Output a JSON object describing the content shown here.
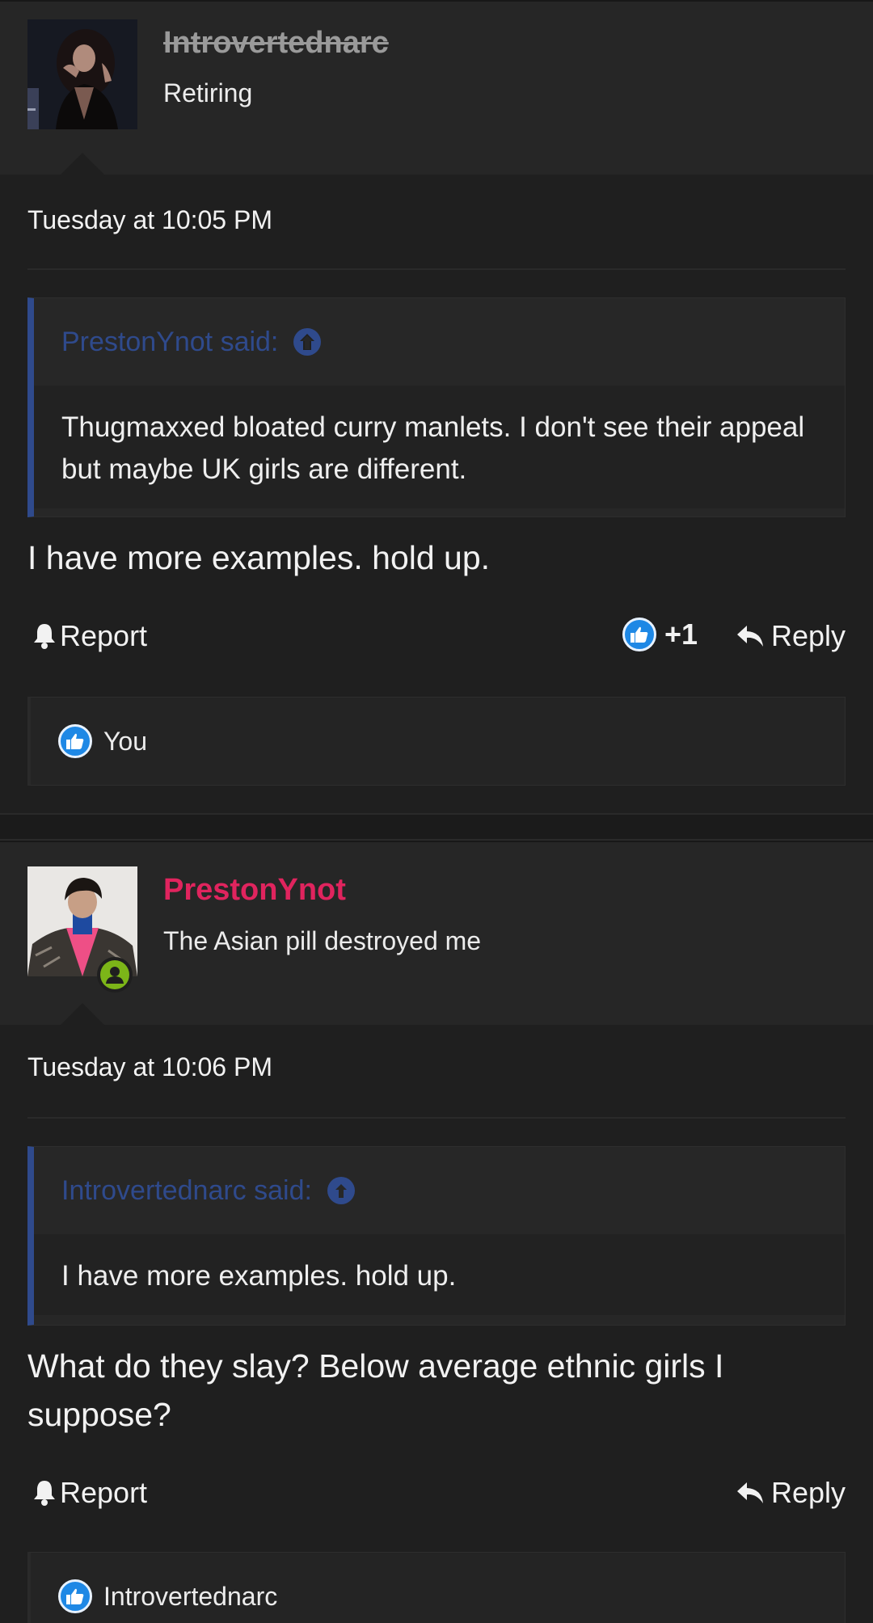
{
  "posts": [
    {
      "author": "Introvertednarc",
      "author_title": "Retiring",
      "author_color": "#9a9a9a",
      "author_strikethrough": true,
      "date": "Tuesday at 10:05 PM",
      "quote": {
        "header": "PrestonYnot said:",
        "text": "Thugmaxxed bloated curry manlets. I don't see their appeal but maybe UK girls are different."
      },
      "body": "I have more examples. hold up.",
      "actions": {
        "report_label": "Report",
        "reaction_count": "+1",
        "reply_label": "Reply"
      },
      "reactions_by": "You"
    },
    {
      "author": "PrestonYnot",
      "author_title": "The Asian pill destroyed me",
      "author_color": "#e0245e",
      "online": true,
      "date": "Tuesday at 10:06 PM",
      "quote": {
        "header": "Introvertednarc said:",
        "text": "I have more examples. hold up."
      },
      "body": "What do they slay? Below average ethnic girls I suppose?",
      "actions": {
        "report_label": "Report",
        "reply_label": "Reply"
      },
      "reactions_by": "Introvertednarc"
    }
  ],
  "colors": {
    "quote_accent": "#2f4a8c",
    "like_blue": "#1e88e5",
    "online_green": "#7cb518"
  },
  "icons": [
    "bell-icon",
    "like-icon",
    "reply-arrow-icon",
    "jump-to-quote-icon",
    "online-status-icon"
  ]
}
